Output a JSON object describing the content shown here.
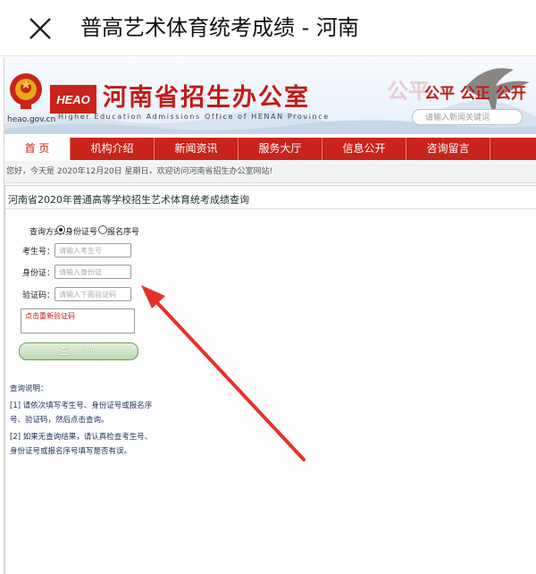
{
  "appbar": {
    "title": "普高艺术体育统考成绩 - 河南"
  },
  "header": {
    "domain": "heao.gov.cn",
    "logo_text": "HEAO",
    "title": "河南省招生办公室",
    "subtitle": "Higher Education Admissions Office of HENAN Province",
    "slogan_ghost": "公平",
    "slogan": "公平 公正 公开",
    "search_placeholder": "请输入新闻关键词"
  },
  "nav": {
    "items": [
      {
        "label": "首 页"
      },
      {
        "label": "机构介绍"
      },
      {
        "label": "新闻资讯"
      },
      {
        "label": "服务大厅"
      },
      {
        "label": "信息公开"
      },
      {
        "label": "咨询留言"
      }
    ]
  },
  "notice": {
    "text": "您好，今天是 2020年12月20日 星期日，欢迎访问河南省招生办公室网站!"
  },
  "section": {
    "title": "河南省2020年普通高等学校招生艺术体育统考成绩查询"
  },
  "form": {
    "mode_label": "查询方式：",
    "mode_option_1": "身份证号",
    "mode_option_2": "报名序号",
    "exam_no_label": "考生号：",
    "exam_no_placeholder": "请输入考生号",
    "id_label": "身份证：",
    "id_placeholder": "请输入身份证",
    "captcha_label": "验证码：",
    "captcha_placeholder": "请输入下面验证码",
    "captcha_refresh": "点击重新验证码",
    "query_button": "查 询"
  },
  "help": {
    "title": "查询说明：",
    "line1": "[1] 请依次填写考生号、身份证号或报名序",
    "line2": "号、验证码，然后点击查询。",
    "line3": "[2] 如果无查询结果，请认真检查考生号、",
    "line4": "身份证号或报名序号填写是否有误。"
  },
  "colors": {
    "brand_red": "#c8241c",
    "annotation_arrow": "#e8302a"
  }
}
